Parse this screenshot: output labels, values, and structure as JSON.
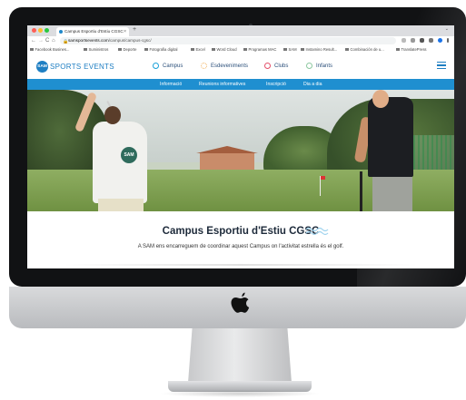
{
  "browser": {
    "tab_title": "Campus Esportiu d'Estiu CGSC",
    "tab_close": "×",
    "new_tab": "+",
    "tab_menu": "⌄",
    "nav": {
      "back": "←",
      "forward": "→",
      "reload": "C",
      "home": "⌂"
    },
    "url_domain": "samsportsevents.com",
    "url_path": "/campus/campus-cgsc/",
    "bookmarks": [
      "Facebook Busines...",
      "Suministros",
      "Deporte",
      "Fotografia digital",
      "Excel",
      "Word Cloud",
      "Programas MAC",
      "SAM",
      "Instamino Result...",
      "Combinación de u...",
      "TranslatePress"
    ]
  },
  "site": {
    "logo_badge": "SAM",
    "logo_text": "SPORTS EVENTS",
    "nav": [
      "Campus",
      "Esdeveniments",
      "Clubs",
      "Infants"
    ],
    "subnav": [
      "Informació",
      "Reunions informatives",
      "Inscripció",
      "Dia a dia"
    ],
    "hero_logo": "SAM",
    "title": "Campus Esportiu d'Estiu CGSC",
    "description": "A SAM ens encarreguem de coordinar aquest Campus on l'activitat estrella és el golf."
  },
  "colors": {
    "brand_blue": "#1f7fc3",
    "subnav_blue": "#1f8fd0",
    "nav_campus_icon": "#1aa0d8",
    "nav_events_icon": "#f2b05a",
    "nav_clubs_icon": "#e4506a",
    "nav_infants_icon": "#8cc8a0"
  },
  "icons": [
    "apple-logo-icon",
    "lock-icon",
    "hamburger-menu-icon",
    "wave-icon"
  ]
}
